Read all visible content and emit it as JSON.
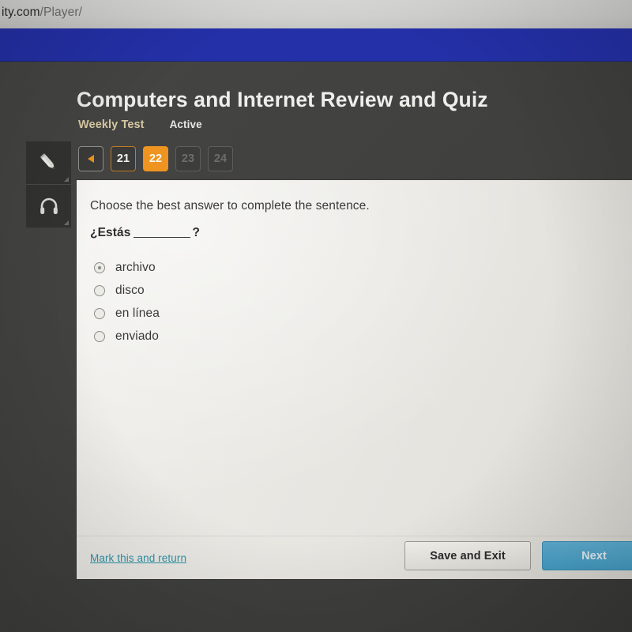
{
  "browser": {
    "url_host": "ity.com",
    "url_path": "/Player/"
  },
  "header": {
    "title": "Computers and Internet Review and Quiz",
    "subtitle": "Weekly Test",
    "status": "Active"
  },
  "tools": [
    {
      "name": "pencil-icon",
      "label": "Draw"
    },
    {
      "name": "headphones-icon",
      "label": "Listen"
    }
  ],
  "pagination": {
    "prev_label": "◀",
    "items": [
      {
        "label": "21",
        "state": "outlined"
      },
      {
        "label": "22",
        "state": "filled"
      },
      {
        "label": "23",
        "state": "disabled"
      },
      {
        "label": "24",
        "state": "disabled"
      }
    ]
  },
  "question": {
    "prompt": "Choose the best answer to complete the sentence.",
    "stem_before": "¿Estás",
    "stem_after": "?",
    "options": [
      {
        "label": "archivo",
        "marked": true
      },
      {
        "label": "disco",
        "marked": false
      },
      {
        "label": "en línea",
        "marked": false
      },
      {
        "label": "enviado",
        "marked": false
      }
    ]
  },
  "footer": {
    "mark_link": "Mark this and return",
    "save_exit": "Save and Exit",
    "next": "Next"
  },
  "colors": {
    "banner_blue": "#2430a8",
    "accent_orange": "#ef9420",
    "next_blue": "#45a0c8",
    "link_teal": "#2e93a8",
    "subtitle_gold": "#d8c9a4",
    "page_dark": "#3f3f3d",
    "card_bg": "#e8e6e0"
  }
}
